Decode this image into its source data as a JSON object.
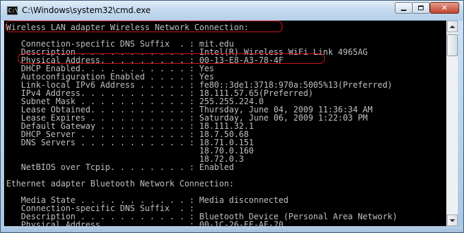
{
  "window": {
    "title": "C:\\Windows\\system32\\cmd.exe",
    "icon_glyph": "C:\\",
    "controls": {
      "minimize": "minimize-icon",
      "maximize": "maximize-icon",
      "close": "close-icon",
      "close_glyph": "✕"
    }
  },
  "colors": {
    "console_bg": "#000000",
    "console_text": "#c0c0c0",
    "highlight": "#d3161c"
  },
  "console": {
    "lines": [
      "Wireless LAN adapter Wireless Network Connection:",
      "",
      "   Connection-specific DNS Suffix  . : mit.edu",
      "   Description . . . . . . . . . . . : Intel(R) Wireless WiFi Link 4965AG",
      "   Physical Address. . . . . . . . . : 00-13-E8-A3-78-4F",
      "   DHCP Enabled. . . . . . . . . . . : Yes",
      "   Autoconfiguration Enabled . . . . : Yes",
      "   Link-local IPv6 Address . . . . . : fe80::3de1:3718:970a:5005%13(Preferred)",
      "   IPv4 Address. . . . . . . . . . . : 18.111.57.65(Preferred)",
      "   Subnet Mask . . . . . . . . . . . : 255.255.224.0",
      "   Lease Obtained. . . . . . . . . . : Thursday, June 04, 2009 11:36:34 AM",
      "   Lease Expires . . . . . . . . . . : Saturday, June 06, 2009 1:22:03 PM",
      "   Default Gateway . . . . . . . . . : 18.111.32.1",
      "   DHCP Server . . . . . . . . . . . : 18.7.50.68",
      "   DNS Servers . . . . . . . . . . . : 18.71.0.151",
      "                                       18.70.0.160",
      "                                       18.72.0.3",
      "   NetBIOS over Tcpip. . . . . . . . : Enabled",
      "",
      "Ethernet adapter Bluetooth Network Connection:",
      "",
      "   Media State . . . . . . . . . . . : Media disconnected",
      "   Connection-specific DNS Suffix  . :",
      "   Description . . . . . . . . . . . : Bluetooth Device (Personal Area Network)",
      "   Physical Address. . . . . . . . . : 00-1C-26-FF-AF-70"
    ]
  }
}
